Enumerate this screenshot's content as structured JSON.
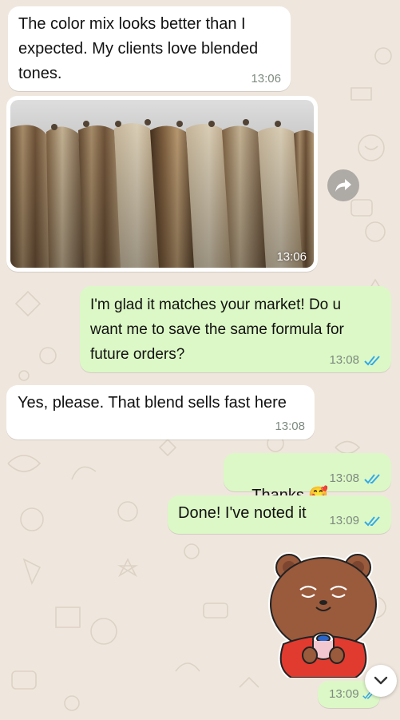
{
  "messages": [
    {
      "id": "m1",
      "direction": "in",
      "text": "The color mix looks better than I\nexpected. My clients love blended\ntones.",
      "time": "13:06"
    },
    {
      "id": "m2",
      "direction": "in",
      "type": "image",
      "image_name": "hair-extension-bundles-photo",
      "time": "13:06"
    },
    {
      "id": "m3",
      "direction": "out",
      "text": "I'm glad it matches your market! Do u\nwant me to save the same formula for\nfuture orders?",
      "time": "13:08",
      "status": "read"
    },
    {
      "id": "m4",
      "direction": "in",
      "text": "Yes, please. That blend sells fast here",
      "time": "13:08"
    },
    {
      "id": "m5",
      "direction": "out",
      "text": "Thanks",
      "emoji": "🥰",
      "time": "13:08",
      "status": "read"
    },
    {
      "id": "m6",
      "direction": "out",
      "text": "Done! I've noted it",
      "time": "13:09",
      "status": "read"
    },
    {
      "id": "m7",
      "direction": "out",
      "type": "sticker",
      "sticker_name": "bear-drinking-coffee-sticker",
      "time": "13:09",
      "status": "read"
    }
  ],
  "icons": {
    "forward": "forward-icon",
    "scroll_down": "chevron-down-icon",
    "read_receipt": "double-check-icon"
  },
  "colors": {
    "background": "#efe7dd",
    "incoming_bubble": "#ffffff",
    "outgoing_bubble": "#dcf8c6",
    "read_tick": "#34a9e8",
    "timestamp": "#7d8a80"
  }
}
